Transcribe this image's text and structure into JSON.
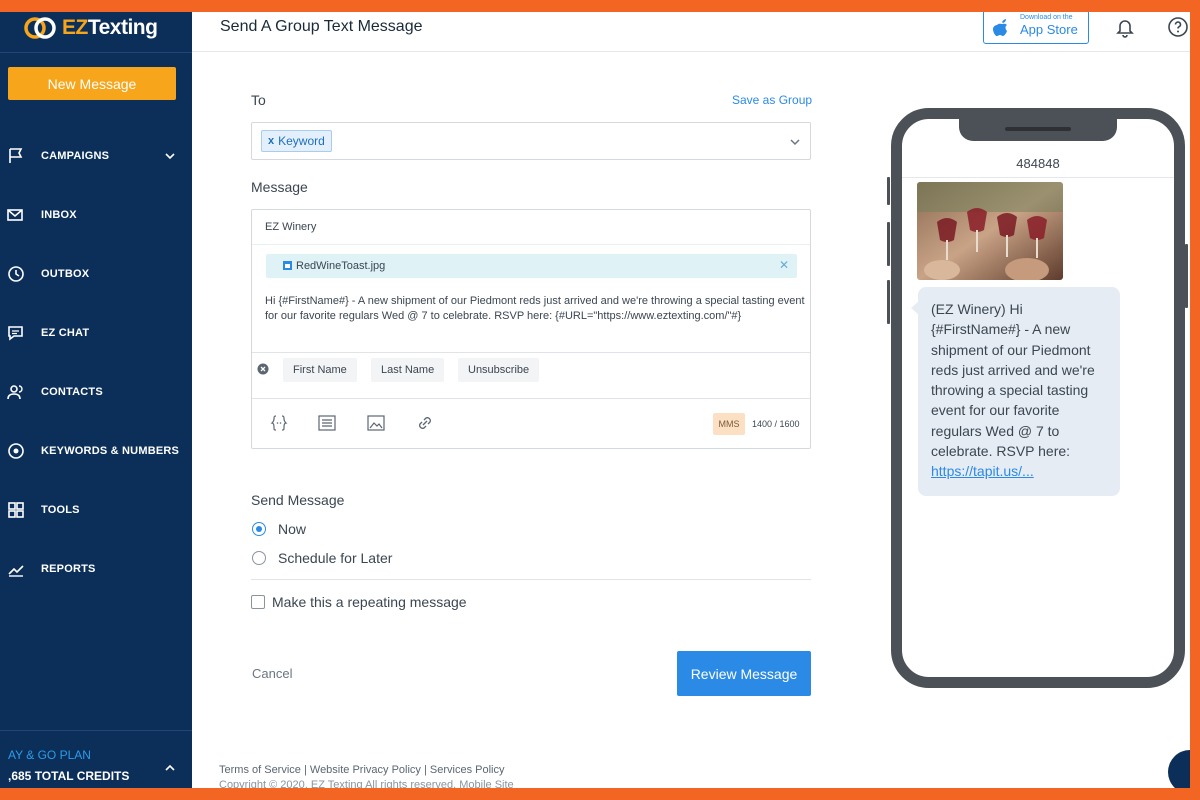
{
  "brand": {
    "logo_text_prefix": "EZ",
    "logo_text_suffix": "Texting",
    "accent": "#f7a51b",
    "sidebar_bg": "#0c2f5a",
    "primary": "#2b8ae6"
  },
  "sidebar": {
    "new_message_label": "New Message",
    "items": [
      {
        "label": "CAMPAIGNS",
        "icon": "flag-icon",
        "has_chevron": true
      },
      {
        "label": "INBOX",
        "icon": "mail-icon"
      },
      {
        "label": "OUTBOX",
        "icon": "clock-icon"
      },
      {
        "label": "EZ CHAT",
        "icon": "chat-icon"
      },
      {
        "label": "CONTACTS",
        "icon": "contacts-icon"
      },
      {
        "label": "KEYWORDS & NUMBERS",
        "icon": "target-icon"
      },
      {
        "label": "TOOLS",
        "icon": "grid-icon"
      },
      {
        "label": "REPORTS",
        "icon": "chart-icon"
      }
    ],
    "plan_label": "AY & GO PLAN",
    "credits_label": ",685 TOTAL CREDITS"
  },
  "header": {
    "title": "Send A Group Text Message",
    "app_store_small": "Download on the",
    "app_store_big": "App Store"
  },
  "form": {
    "to_label": "To",
    "save_as_group": "Save as Group",
    "recipient_chip": "Keyword",
    "message_label": "Message",
    "sender_name": "EZ Winery",
    "attachment_name": "RedWineToast.jpg",
    "message_body": "Hi {#FirstName#} - A new shipment of our Piedmont reds just arrived and we're throwing a special tasting event for our favorite regulars Wed @ 7 to celebrate. RSVP here: {#URL=\"https://www.eztexting.com/\"#}",
    "tags": [
      "First Name",
      "Last Name",
      "Unsubscribe"
    ],
    "message_type": "MMS",
    "char_count": "1400 / 1600",
    "send_label": "Send Message",
    "send_options": [
      "Now",
      "Schedule for Later"
    ],
    "selected_send_option": "Now",
    "repeat_label": "Make this a repeating message",
    "cancel_label": "Cancel",
    "review_label": "Review Message"
  },
  "footer": {
    "links": "Terms of Service  |  Website Privacy Policy  |  Services Policy",
    "copyright": "Copyright © 2020. EZ Texting All rights reserved. Mobile Site"
  },
  "phone": {
    "number": "484848",
    "bubble_text": "(EZ Winery) Hi {#FirstName#} - A new shipment of our Piedmont reds just arrived and we're throwing a special tasting event for our favorite regulars Wed @ 7 to celebrate. RSVP here:",
    "bubble_url": "https://tapit.us/..."
  }
}
